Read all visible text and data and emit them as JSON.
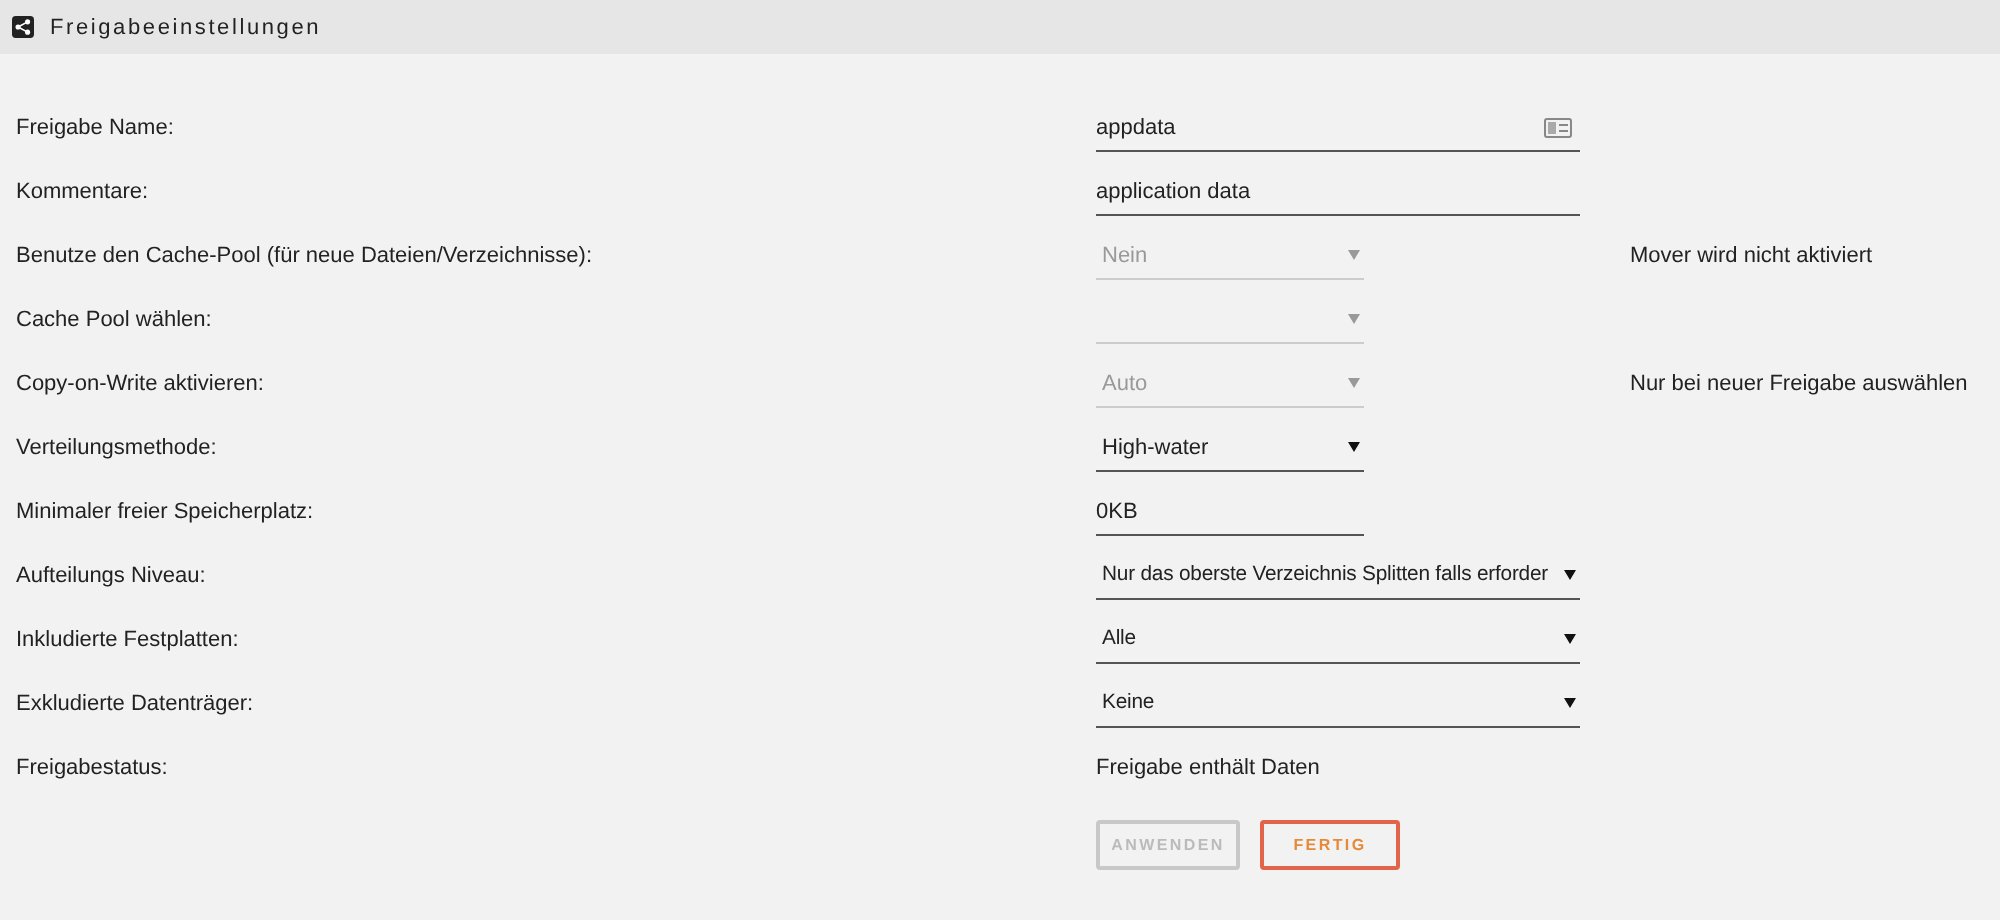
{
  "header": {
    "title": "Freigabeeinstellungen"
  },
  "rows": [
    {
      "label": "Freigabe Name:",
      "kind": "wide-input",
      "value": "appdata",
      "icon": true
    },
    {
      "label": "Kommentare:",
      "kind": "wide-input",
      "value": "application data"
    },
    {
      "label": "Benutze den Cache-Pool (für neue Dateien/Verzeichnisse):",
      "kind": "select",
      "value": "Nein",
      "disabled": true,
      "note": "Mover wird nicht aktiviert"
    },
    {
      "label": "Cache Pool wählen:",
      "kind": "select",
      "disabled": true
    },
    {
      "label": "Copy-on-Write aktivieren:",
      "kind": "select",
      "value": "Auto",
      "disabled": true,
      "note": "Nur bei neuer Freigabe auswählen"
    },
    {
      "label": "Verteilungsmethode:",
      "kind": "select",
      "value": "High-water",
      "disabled": false
    },
    {
      "label": "Minimaler freier Speicherplatz:",
      "kind": "input",
      "value": "0KB"
    },
    {
      "label": "Aufteilungs Niveau:",
      "kind": "wide-select",
      "value": "Nur das oberste Verzeichnis Splitten falls erforder",
      "disabled": false
    },
    {
      "label": "Inkludierte Festplatten:",
      "kind": "wide-select",
      "value": "Alle",
      "disabled": false
    },
    {
      "label": "Exkludierte Datenträger:",
      "kind": "wide-select",
      "value": "Keine",
      "disabled": false
    },
    {
      "label": "Freigabestatus:",
      "kind": "text",
      "value": "Freigabe enthält Daten"
    }
  ],
  "buttons": [
    {
      "label": "ANWENDEN",
      "disabled": true
    },
    {
      "label": "FERTIG",
      "disabled": false
    }
  ]
}
